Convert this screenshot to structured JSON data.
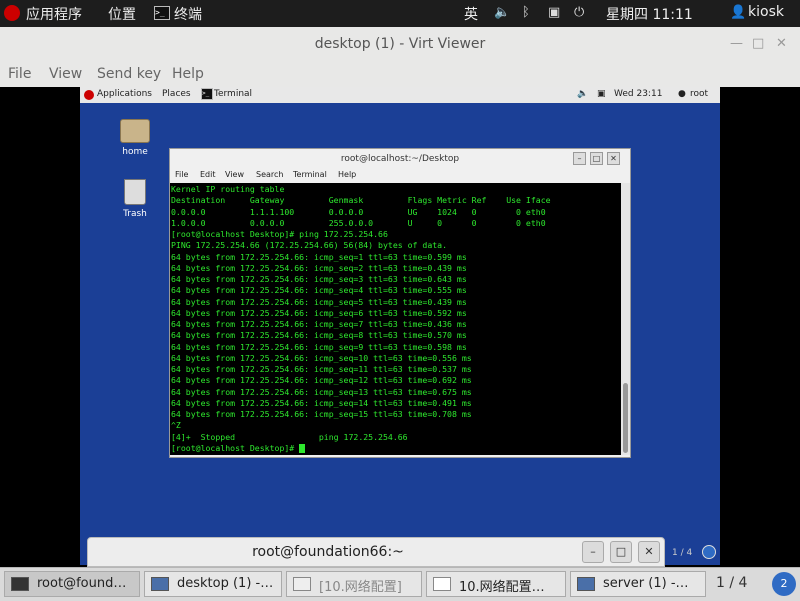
{
  "host_topbar": {
    "apps_label": "应用程序",
    "places_label": "位置",
    "active_app": "终端",
    "ime": "英",
    "datetime": "星期四 11:11",
    "user": "kiosk"
  },
  "virt_viewer": {
    "title": "desktop (1) - Virt Viewer",
    "menu": [
      "File",
      "View",
      "Send key",
      "Help"
    ]
  },
  "guest": {
    "topbar": {
      "applications": "Applications",
      "places": "Places",
      "terminal": "Terminal",
      "datetime": "Wed 23:11",
      "user": "root"
    },
    "desktop_icons": [
      "home",
      "Trash"
    ],
    "terminal": {
      "title": "root@localhost:~/Desktop",
      "menu": [
        "File",
        "Edit",
        "View",
        "Search",
        "Terminal",
        "Help"
      ],
      "lines": [
        "Kernel IP routing table",
        "Destination     Gateway         Genmask         Flags Metric Ref    Use Iface",
        "0.0.0.0         1.1.1.100       0.0.0.0         UG    1024   0        0 eth0",
        "1.0.0.0         0.0.0.0         255.0.0.0       U     0      0        0 eth0",
        "[root@localhost Desktop]# ping 172.25.254.66",
        "PING 172.25.254.66 (172.25.254.66) 56(84) bytes of data.",
        "64 bytes from 172.25.254.66: icmp_seq=1 ttl=63 time=0.599 ms",
        "64 bytes from 172.25.254.66: icmp_seq=2 ttl=63 time=0.439 ms",
        "64 bytes from 172.25.254.66: icmp_seq=3 ttl=63 time=0.643 ms",
        "64 bytes from 172.25.254.66: icmp_seq=4 ttl=63 time=0.555 ms",
        "64 bytes from 172.25.254.66: icmp_seq=5 ttl=63 time=0.439 ms",
        "64 bytes from 172.25.254.66: icmp_seq=6 ttl=63 time=0.592 ms",
        "64 bytes from 172.25.254.66: icmp_seq=7 ttl=63 time=0.436 ms",
        "64 bytes from 172.25.254.66: icmp_seq=8 ttl=63 time=0.570 ms",
        "64 bytes from 172.25.254.66: icmp_seq=9 ttl=63 time=0.598 ms",
        "64 bytes from 172.25.254.66: icmp_seq=10 ttl=63 time=0.556 ms",
        "64 bytes from 172.25.254.66: icmp_seq=11 ttl=63 time=0.537 ms",
        "64 bytes from 172.25.254.66: icmp_seq=12 ttl=63 time=0.692 ms",
        "64 bytes from 172.25.254.66: icmp_seq=13 ttl=63 time=0.675 ms",
        "64 bytes from 172.25.254.66: icmp_seq=14 ttl=63 time=0.491 ms",
        "64 bytes from 172.25.254.66: icmp_seq=15 ttl=63 time=0.708 ms",
        "^Z",
        "[4]+  Stopped                 ping 172.25.254.66"
      ],
      "prompt": "[root@localhost Desktop]# "
    }
  },
  "host_terminal": {
    "title": "root@foundation66:~"
  },
  "host_pager_small": "1 / 4",
  "taskbar": {
    "tasks": [
      "root@found…",
      "desktop (1) -…",
      "[10.网络配置]",
      "10.网络配置…",
      "server (1) -…"
    ],
    "pager": "1 / 4"
  },
  "colors": {
    "guest_desktop": "#1b3f96",
    "terminal_text": "#2ee82e"
  }
}
